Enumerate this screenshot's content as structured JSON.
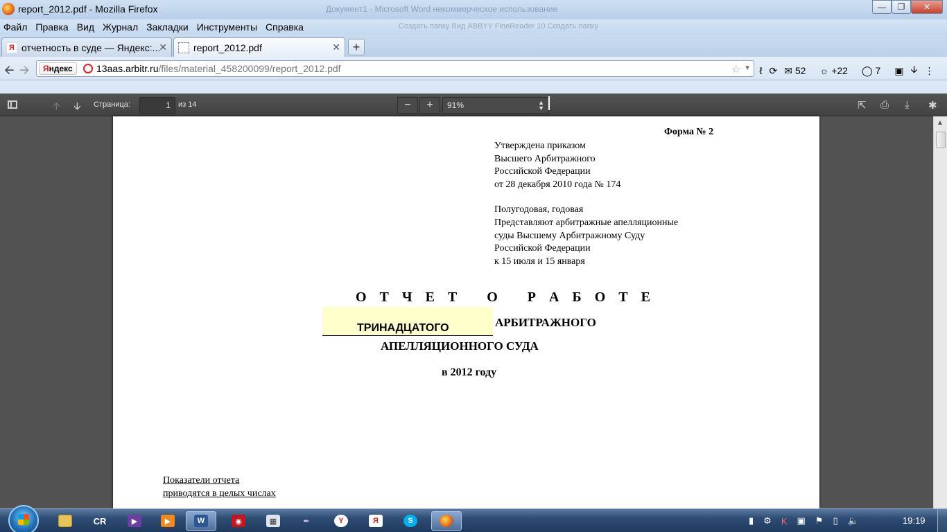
{
  "window": {
    "title": "report_2012.pdf - Mozilla Firefox",
    "background_ghost_title": "Документ1 - Microsoft Word некоммерческое использование"
  },
  "menu": {
    "items": [
      "Файл",
      "Правка",
      "Вид",
      "Журнал",
      "Закладки",
      "Инструменты",
      "Справка"
    ],
    "background_ghost": "Создать папку    Вид    ABBYY FineReader 10    Создать папку"
  },
  "tabs": [
    {
      "label": "отчетность в суде — Яндекс:...",
      "favicon": "Я",
      "active": false
    },
    {
      "label": "report_2012.pdf",
      "active": true
    }
  ],
  "nav": {
    "yandex_label_red": "Я",
    "yandex_label_rest": "ндекс",
    "url_domain": "13aas.arbitr.ru",
    "url_path": "/files/material_458200099/report_2012.pdf",
    "mail_count": "52",
    "weather": "+22",
    "ext_count": "7"
  },
  "pdf_toolbar": {
    "page_label": "Страница:",
    "page_value": "1",
    "page_total": "из 14",
    "zoom_value": "91%"
  },
  "document": {
    "form_no": "Форма № 2",
    "approval_lines": [
      "Утверждена приказом",
      "Высшего Арбитражного",
      "Российской Федерации",
      "от 28 декабря 2010 года № 174"
    ],
    "submission_lines": [
      "Полугодовая, годовая",
      "Представляют арбитражные апелляционные",
      "суды Высшему Арбитражному Суду",
      "Российской Федерации",
      "к 15 июля и 15 января"
    ],
    "title": "О Т Ч Е Т   О   Р А Б О Т Е",
    "court_number": "ТРИНАДЦАТОГО",
    "court_word1": "АРБИТРАЖНОГО",
    "court_word2": "АПЕЛЛЯЦИОННОГО СУДА",
    "year_line": "в 2012 году",
    "footer_lines": [
      "Показатели отчета",
      "приводятся в целых числах"
    ]
  },
  "taskbar": {
    "apps": [
      "explorer",
      "CR",
      "visual-studio",
      "media-player",
      "word",
      "app-red",
      "calculator",
      "pen-tool",
      "yandex-browser",
      "yandex",
      "skype",
      "firefox"
    ],
    "clock": "19:19"
  },
  "colors": {
    "pdf_toolbar": "#474747",
    "viewer_bg": "#525252",
    "highlight_field": "#ffffcc",
    "chrome_blue": "#c8daee"
  }
}
